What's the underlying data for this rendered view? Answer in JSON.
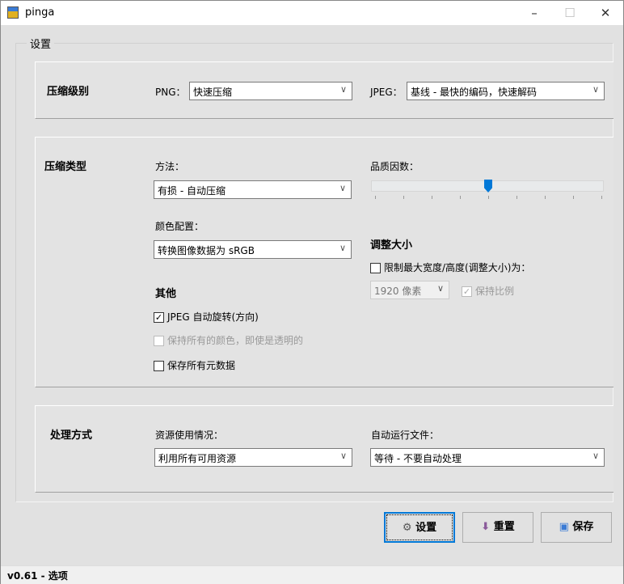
{
  "window": {
    "title": "pinga",
    "min": "–",
    "max": "☐",
    "close": "✕"
  },
  "group_label": "设置",
  "compression_level": {
    "heading": "压缩级别",
    "png_label": "PNG：",
    "png_value": "快速压缩",
    "jpeg_label": "JPEG：",
    "jpeg_value": "基线 - 最快的编码，快速解码"
  },
  "compression_type": {
    "heading": "压缩类型",
    "method_label": "方法：",
    "method_value": "有损 - 自动压缩",
    "color_label": "颜色配置：",
    "color_value": "转换图像数据为 sRGB",
    "quality_label": "品质因数：",
    "quality_value_fraction": 0.5,
    "other_heading": "其他",
    "opt_rotate": "JPEG 自动旋转(方向)",
    "opt_rotate_checked": true,
    "opt_keep_colors": "保持所有的颜色，即使是透明的",
    "opt_keep_colors_checked": false,
    "opt_metadata": "保存所有元数据",
    "opt_metadata_checked": false,
    "resize_heading": "调整大小",
    "resize_limit": "限制最大宽度/高度(调整大小)为：",
    "resize_limit_checked": false,
    "resize_size": "1920 像素",
    "keep_ratio": "保持比例",
    "keep_ratio_checked": true
  },
  "processing": {
    "heading": "处理方式",
    "resource_label": "资源使用情况：",
    "resource_value": "利用所有可用资源",
    "auto_label": "自动运行文件：",
    "auto_value": "等待 - 不要自动处理"
  },
  "buttons": {
    "settings": "设置",
    "reset": "重置",
    "save": "保存"
  },
  "status": "v0.61 - 选项",
  "colors": {
    "accent": "#0078d7"
  }
}
